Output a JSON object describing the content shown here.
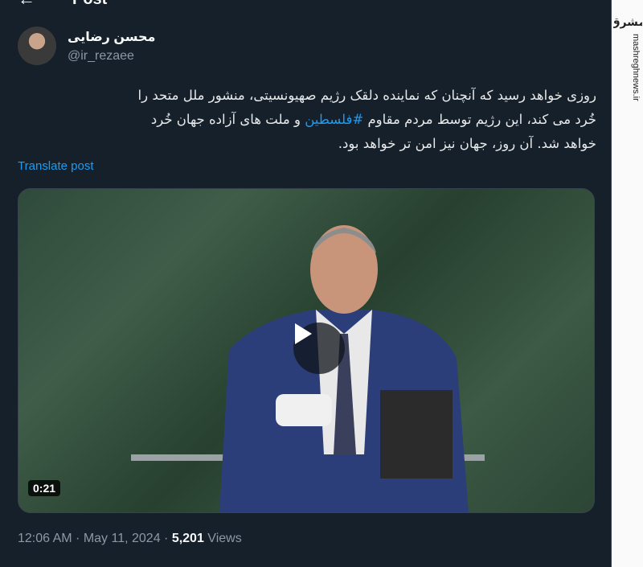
{
  "header": {
    "back_icon": "back-arrow-icon",
    "title": "Post"
  },
  "author": {
    "name": "محسن رضایی",
    "handle": "@ir_rezaee"
  },
  "tweet": {
    "line1": "روزی خواهد رسید که آنچنان که نماینده دلقک رژیم صهیونسیتی، منشور ملل متحد را",
    "line2_pre": "خُرد می کند، این رژیم توسط مردم مقاوم ",
    "hashtag": "#فلسطین",
    "line2_post": " و ملت های آزاده جهان خُرد",
    "line3": "خواهد شد. آن روز، جهان نیز امن تر خواهد بود.",
    "translate_label": "Translate post"
  },
  "video": {
    "duration": "0:21",
    "play_icon": "play-icon"
  },
  "meta": {
    "time": "12:06 AM",
    "sep1": " · ",
    "date": "May 11, 2024",
    "sep2": " · ",
    "views_count": "5,201",
    "views_label": " Views"
  },
  "watermark": {
    "logo_text": "مشرق",
    "url": "mashreghnews.ir"
  },
  "colors": {
    "background": "#15202b",
    "link": "#1d9bf0",
    "muted": "#8b98a5"
  }
}
